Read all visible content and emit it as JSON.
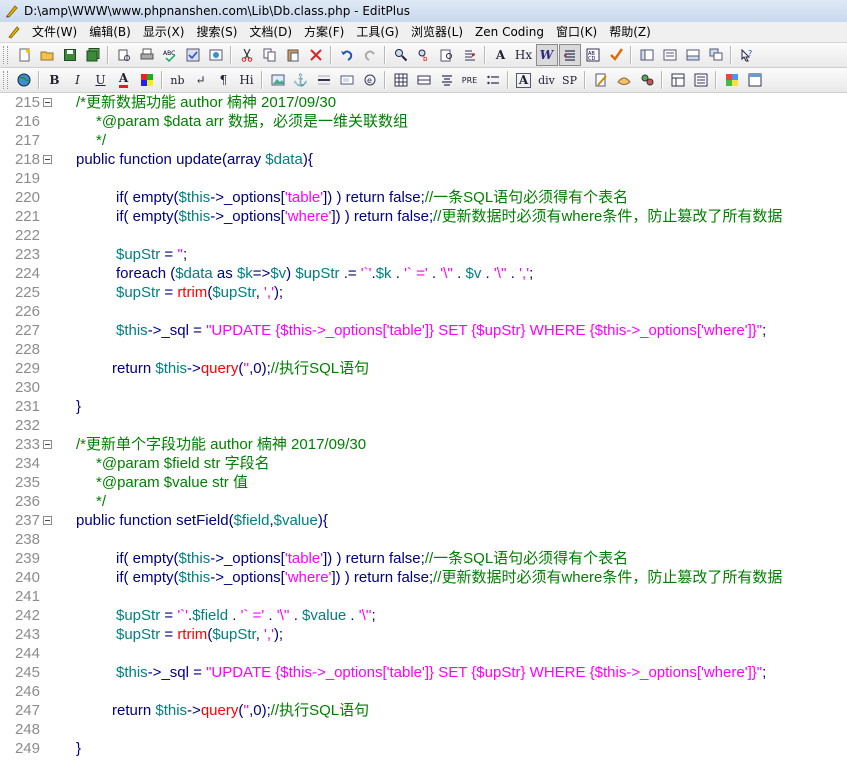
{
  "window": {
    "title": "D:\\amp\\WWW\\www.phpnanshen.com\\Lib\\Db.class.php - EditPlus"
  },
  "menu": {
    "items": [
      "文件(W)",
      "编辑(B)",
      "显示(X)",
      "搜索(S)",
      "文档(D)",
      "方案(F)",
      "工具(G)",
      "浏览器(L)",
      "Zen Coding",
      "窗口(K)",
      "帮助(Z)"
    ]
  },
  "toolbar1": {
    "buttons": [
      {
        "name": "new-file-icon"
      },
      {
        "name": "open-folder-icon"
      },
      {
        "name": "save-icon"
      },
      {
        "name": "save-all-icon"
      },
      {
        "sep": true
      },
      {
        "name": "print-preview-icon"
      },
      {
        "name": "print-icon"
      },
      {
        "name": "spell-check-icon"
      },
      {
        "name": "check-icon"
      },
      {
        "name": "browser-preview-icon"
      },
      {
        "sep": true
      },
      {
        "name": "cut-icon"
      },
      {
        "name": "copy-icon"
      },
      {
        "name": "paste-icon"
      },
      {
        "name": "delete-icon"
      },
      {
        "sep": true
      },
      {
        "name": "undo-icon"
      },
      {
        "name": "redo-icon"
      },
      {
        "sep": true
      },
      {
        "name": "find-icon"
      },
      {
        "name": "replace-icon"
      },
      {
        "name": "find-in-files-icon"
      },
      {
        "name": "goto-line-icon"
      },
      {
        "sep": true
      },
      {
        "name": "font-size-icon",
        "text": "A"
      },
      {
        "name": "hex-icon",
        "text": "Hx"
      },
      {
        "name": "word-wrap-icon",
        "text": "W",
        "pressed": true
      },
      {
        "name": "line-number-icon",
        "pressed": true
      },
      {
        "name": "column-select-icon"
      },
      {
        "name": "spell-check-mark-icon"
      },
      {
        "sep": true
      },
      {
        "name": "directory-window-icon"
      },
      {
        "name": "clip-library-icon"
      },
      {
        "name": "output-window-icon"
      },
      {
        "name": "window-list-icon"
      },
      {
        "sep": true
      },
      {
        "name": "help-icon"
      }
    ]
  },
  "toolbar2": {
    "buttons": [
      {
        "name": "browser-icon"
      },
      {
        "sep": true
      },
      {
        "name": "bold-icon",
        "text": "B"
      },
      {
        "name": "italic-icon",
        "text": "I"
      },
      {
        "name": "underline-icon",
        "text": "U"
      },
      {
        "name": "font-color-icon",
        "text": "A"
      },
      {
        "name": "color-picker-icon"
      },
      {
        "sep": true
      },
      {
        "name": "nbsp-icon",
        "text": "nb"
      },
      {
        "name": "line-break-icon",
        "text": "↵"
      },
      {
        "name": "paragraph-icon",
        "text": "¶"
      },
      {
        "name": "heading-icon",
        "text": "Hi"
      },
      {
        "sep": true
      },
      {
        "name": "image-icon"
      },
      {
        "name": "anchor-icon",
        "text": "⚓"
      },
      {
        "name": "horizontal-rule-icon"
      },
      {
        "name": "form-icon"
      },
      {
        "name": "comment-icon"
      },
      {
        "sep": true
      },
      {
        "name": "table-icon"
      },
      {
        "name": "table-row-icon"
      },
      {
        "name": "center-icon"
      },
      {
        "name": "pre-icon",
        "text": "PRE"
      },
      {
        "name": "list-icon"
      },
      {
        "sep": true
      },
      {
        "name": "font-tag-icon",
        "text": "A"
      },
      {
        "name": "div-icon",
        "text": "div"
      },
      {
        "name": "span-icon",
        "text": "SP"
      },
      {
        "sep": true
      },
      {
        "name": "css-edit-icon"
      },
      {
        "name": "css-property-icon"
      },
      {
        "name": "script-icon"
      },
      {
        "sep": true
      },
      {
        "name": "html-toolbar-icon"
      },
      {
        "name": "html-menu-icon"
      },
      {
        "sep": true
      },
      {
        "name": "color-palette-icon"
      },
      {
        "name": "dialog-icon"
      }
    ]
  },
  "editor": {
    "lines": [
      {
        "n": "215",
        "fold": true,
        "indent": 0,
        "tokens": [
          [
            "cmt",
            "/*更新数据功能 author 楠神 2017/09/30"
          ]
        ]
      },
      {
        "n": "216",
        "fold": false,
        "indent": 1,
        "tokens": [
          [
            "cmt",
            "*@param $data arr 数据，必须是一维关联数组"
          ]
        ]
      },
      {
        "n": "217",
        "fold": false,
        "indent": 1,
        "tokens": [
          [
            "cmt",
            "*/"
          ]
        ]
      },
      {
        "n": "218",
        "fold": true,
        "indent": 0,
        "tokens": [
          [
            "def",
            "public function update(array "
          ],
          [
            "var",
            "$data"
          ],
          [
            "def",
            "){"
          ]
        ]
      },
      {
        "n": "219",
        "fold": false,
        "indent": 0,
        "tokens": []
      },
      {
        "n": "220",
        "fold": false,
        "indent": 2,
        "tokens": [
          [
            "kw",
            "if( empty("
          ],
          [
            "var",
            "$this"
          ],
          [
            "kw",
            "->_options["
          ],
          [
            "str",
            "'table'"
          ],
          [
            "kw",
            "]) ) return false;"
          ],
          [
            "cmt",
            "//一条SQL语句必须得有个表名"
          ]
        ]
      },
      {
        "n": "221",
        "fold": false,
        "indent": 2,
        "tokens": [
          [
            "kw",
            "if( empty("
          ],
          [
            "var",
            "$this"
          ],
          [
            "kw",
            "->_options["
          ],
          [
            "str",
            "'where'"
          ],
          [
            "kw",
            "]) ) return false;"
          ],
          [
            "cmt",
            "//更新数据时必须有where条件，防止篡改了所有数据"
          ]
        ]
      },
      {
        "n": "222",
        "fold": false,
        "indent": 0,
        "tokens": []
      },
      {
        "n": "223",
        "fold": false,
        "indent": 2,
        "tokens": [
          [
            "var",
            "$upStr"
          ],
          [
            "def",
            " = "
          ],
          [
            "str",
            "''"
          ],
          [
            "def",
            ";"
          ]
        ]
      },
      {
        "n": "224",
        "fold": false,
        "indent": 2,
        "tokens": [
          [
            "kw",
            "foreach ("
          ],
          [
            "var",
            "$data"
          ],
          [
            "kw",
            " as "
          ],
          [
            "var",
            "$k"
          ],
          [
            "kw",
            "=>"
          ],
          [
            "var",
            "$v"
          ],
          [
            "kw",
            ") "
          ],
          [
            "var",
            "$upStr"
          ],
          [
            "kw",
            " .= "
          ],
          [
            "str",
            "'`'"
          ],
          [
            "kw",
            "."
          ],
          [
            "var",
            "$k"
          ],
          [
            "kw",
            " . "
          ],
          [
            "str",
            "'` ='"
          ],
          [
            "kw",
            " . "
          ],
          [
            "str",
            "'\\''"
          ],
          [
            "kw",
            " . "
          ],
          [
            "var",
            "$v"
          ],
          [
            "kw",
            " . "
          ],
          [
            "str",
            "'\\''"
          ],
          [
            "kw",
            " . "
          ],
          [
            "str",
            "','"
          ],
          [
            "kw",
            ";"
          ]
        ]
      },
      {
        "n": "225",
        "fold": false,
        "indent": 2,
        "tokens": [
          [
            "var",
            "$upStr"
          ],
          [
            "def",
            " = "
          ],
          [
            "fn",
            "rtrim"
          ],
          [
            "def",
            "("
          ],
          [
            "var",
            "$upStr"
          ],
          [
            "def",
            ", "
          ],
          [
            "str",
            "','"
          ],
          [
            "def",
            ");"
          ]
        ]
      },
      {
        "n": "226",
        "fold": false,
        "indent": 0,
        "tokens": []
      },
      {
        "n": "227",
        "fold": false,
        "indent": 2,
        "tokens": [
          [
            "var",
            "$this"
          ],
          [
            "def",
            "->_sql = "
          ],
          [
            "str",
            "\"UPDATE {$this->_options['table']} SET {$upStr} WHERE {$this->_options['where']}\""
          ],
          [
            "def",
            ";"
          ]
        ]
      },
      {
        "n": "228",
        "fold": false,
        "indent": 0,
        "tokens": []
      },
      {
        "n": "229",
        "fold": false,
        "indent": 1.8,
        "tokens": [
          [
            "kw",
            "return "
          ],
          [
            "var",
            "$this"
          ],
          [
            "kw",
            "->"
          ],
          [
            "fn",
            "query"
          ],
          [
            "kw",
            "("
          ],
          [
            "str",
            "''"
          ],
          [
            "kw",
            ",0);"
          ],
          [
            "cmt",
            "//执行SQL语句"
          ]
        ]
      },
      {
        "n": "230",
        "fold": false,
        "indent": 0,
        "tokens": []
      },
      {
        "n": "231",
        "fold": false,
        "indent": 0,
        "tokens": [
          [
            "def",
            "}"
          ]
        ]
      },
      {
        "n": "232",
        "fold": false,
        "indent": 0,
        "tokens": []
      },
      {
        "n": "233",
        "fold": true,
        "indent": 0,
        "tokens": [
          [
            "cmt",
            "/*更新单个字段功能 author 楠神 2017/09/30"
          ]
        ]
      },
      {
        "n": "234",
        "fold": false,
        "indent": 1,
        "tokens": [
          [
            "cmt",
            "*@param $field str 字段名"
          ]
        ]
      },
      {
        "n": "235",
        "fold": false,
        "indent": 1,
        "tokens": [
          [
            "cmt",
            "*@param $value str 值"
          ]
        ]
      },
      {
        "n": "236",
        "fold": false,
        "indent": 1,
        "tokens": [
          [
            "cmt",
            "*/"
          ]
        ]
      },
      {
        "n": "237",
        "fold": true,
        "indent": 0,
        "tokens": [
          [
            "def",
            "public function setField("
          ],
          [
            "var",
            "$field"
          ],
          [
            "def",
            ","
          ],
          [
            "var",
            "$value"
          ],
          [
            "def",
            "){"
          ]
        ]
      },
      {
        "n": "238",
        "fold": false,
        "indent": 0,
        "tokens": []
      },
      {
        "n": "239",
        "fold": false,
        "indent": 2,
        "tokens": [
          [
            "kw",
            "if( empty("
          ],
          [
            "var",
            "$this"
          ],
          [
            "kw",
            "->_options["
          ],
          [
            "str",
            "'table'"
          ],
          [
            "kw",
            "]) ) return false;"
          ],
          [
            "cmt",
            "//一条SQL语句必须得有个表名"
          ]
        ]
      },
      {
        "n": "240",
        "fold": false,
        "indent": 2,
        "tokens": [
          [
            "kw",
            "if( empty("
          ],
          [
            "var",
            "$this"
          ],
          [
            "kw",
            "->_options["
          ],
          [
            "str",
            "'where'"
          ],
          [
            "kw",
            "]) ) return false;"
          ],
          [
            "cmt",
            "//更新数据时必须有where条件，防止篡改了所有数据"
          ]
        ]
      },
      {
        "n": "241",
        "fold": false,
        "indent": 0,
        "tokens": []
      },
      {
        "n": "242",
        "fold": false,
        "indent": 2,
        "tokens": [
          [
            "var",
            "$upStr"
          ],
          [
            "def",
            " = "
          ],
          [
            "str",
            "'`'"
          ],
          [
            "def",
            "."
          ],
          [
            "var",
            "$field"
          ],
          [
            "def",
            " . "
          ],
          [
            "str",
            "'` ='"
          ],
          [
            "def",
            " . "
          ],
          [
            "str",
            "'\\''"
          ],
          [
            "def",
            " . "
          ],
          [
            "var",
            "$value"
          ],
          [
            "def",
            " . "
          ],
          [
            "str",
            "'\\''"
          ],
          [
            "def",
            ";"
          ]
        ]
      },
      {
        "n": "243",
        "fold": false,
        "indent": 2,
        "tokens": [
          [
            "var",
            "$upStr"
          ],
          [
            "def",
            " = "
          ],
          [
            "fn",
            "rtrim"
          ],
          [
            "def",
            "("
          ],
          [
            "var",
            "$upStr"
          ],
          [
            "def",
            ", "
          ],
          [
            "str",
            "','"
          ],
          [
            "def",
            ");"
          ]
        ]
      },
      {
        "n": "244",
        "fold": false,
        "indent": 0,
        "tokens": []
      },
      {
        "n": "245",
        "fold": false,
        "indent": 2,
        "tokens": [
          [
            "var",
            "$this"
          ],
          [
            "def",
            "->_sql = "
          ],
          [
            "str",
            "\"UPDATE {$this->_options['table']} SET {$upStr} WHERE {$this->_options['where']}\""
          ],
          [
            "def",
            ";"
          ]
        ]
      },
      {
        "n": "246",
        "fold": false,
        "indent": 0,
        "tokens": []
      },
      {
        "n": "247",
        "fold": false,
        "indent": 1.8,
        "tokens": [
          [
            "kw",
            "return "
          ],
          [
            "var",
            "$this"
          ],
          [
            "kw",
            "->"
          ],
          [
            "fn",
            "query"
          ],
          [
            "kw",
            "("
          ],
          [
            "str",
            "''"
          ],
          [
            "kw",
            ",0);"
          ],
          [
            "cmt",
            "//执行SQL语句"
          ]
        ]
      },
      {
        "n": "248",
        "fold": false,
        "indent": 0,
        "tokens": []
      },
      {
        "n": "249",
        "fold": false,
        "indent": 0,
        "tokens": [
          [
            "def",
            "}"
          ]
        ]
      }
    ]
  },
  "colors": {
    "default": "#000080",
    "string": "#ff00ff",
    "comment": "#008000",
    "variable": "#008080",
    "function_call": "#ff0000",
    "line_number": "#8c8c8c"
  }
}
